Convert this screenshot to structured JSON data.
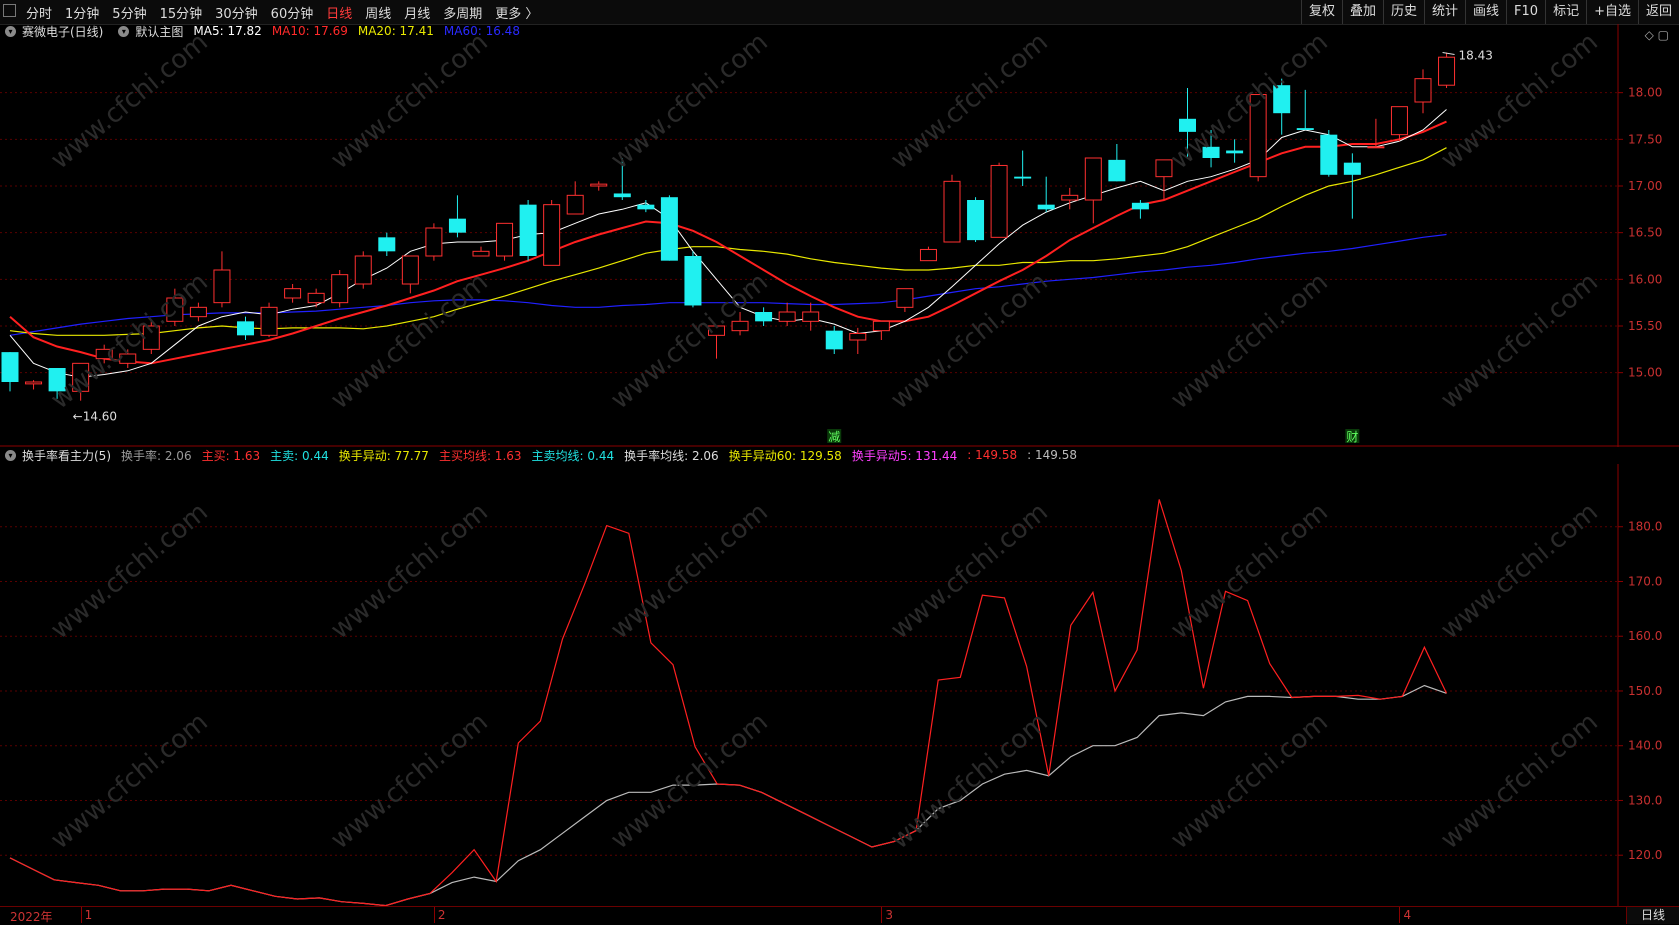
{
  "toolbar": {
    "timeframes": [
      "分时",
      "1分钟",
      "5分钟",
      "15分钟",
      "30分钟",
      "60分钟",
      "日线",
      "周线",
      "月线",
      "多周期",
      "更多 〉"
    ],
    "active_timeframe": "日线",
    "right_buttons": [
      "复权",
      "叠加",
      "历史",
      "统计",
      "画线",
      "F10",
      "标记",
      "+自选",
      "返回"
    ]
  },
  "main_legend": {
    "title": "赛微电子(日线)",
    "main_chart_label": "默认主图",
    "items": [
      {
        "label": "MA5: 17.82",
        "color": "#ffffff"
      },
      {
        "label": "MA10: 17.69",
        "color": "#ff2a2a"
      },
      {
        "label": "MA20: 17.41",
        "color": "#e8e800"
      },
      {
        "label": "MA60: 16.48",
        "color": "#2a2aff"
      }
    ]
  },
  "sub_legend": {
    "title": "换手率看主力(5)",
    "items": [
      {
        "label": "换手率: 2.06",
        "color": "#9a9a9a"
      },
      {
        "label": "主买: 1.63",
        "color": "#ff3030"
      },
      {
        "label": "主卖: 0.44",
        "color": "#20e0e0"
      },
      {
        "label": "换手异动: 77.77",
        "color": "#e8e800"
      },
      {
        "label": "主买均线: 1.63",
        "color": "#ff3030"
      },
      {
        "label": "主卖均线: 0.44",
        "color": "#20e0e0"
      },
      {
        "label": "换手率均线: 2.06",
        "color": "#dddddd"
      },
      {
        "label": "换手异动60: 129.58",
        "color": "#e8e800"
      },
      {
        "label": "换手异动5: 131.44",
        "color": "#ff40ff"
      },
      {
        "label": ": 149.58",
        "color": "#ff3030"
      },
      {
        "label": ": 149.58",
        "color": "#bbbbbb"
      }
    ]
  },
  "price_markers": {
    "high": "18.43",
    "low": "14.60"
  },
  "event_markers": [
    {
      "text": "减",
      "index": 35
    },
    {
      "text": "财",
      "index": 57
    }
  ],
  "watermark": "www.cfchi.com",
  "date_axis": {
    "year_label": "2022年",
    "months": [
      {
        "label": "1",
        "index": 3
      },
      {
        "label": "2",
        "index": 18
      },
      {
        "label": "3",
        "index": 37
      },
      {
        "label": "4",
        "index": 59
      }
    ]
  },
  "bottom_button": "日线",
  "chart_data": [
    {
      "type": "candlestick",
      "title": "赛微电子(日线)",
      "ylim": [
        14.45,
        18.65
      ],
      "y_ticks": [
        "15.00",
        "15.50",
        "16.00",
        "16.50",
        "17.00",
        "17.50",
        "18.00"
      ],
      "y_tick_values": [
        15.0,
        15.5,
        16.0,
        16.5,
        17.0,
        17.5,
        18.0
      ],
      "candles": [
        [
          15.22,
          14.9,
          15.22,
          14.8
        ],
        [
          14.88,
          14.9,
          14.92,
          14.82
        ],
        [
          15.05,
          14.8,
          15.05,
          14.72
        ],
        [
          14.8,
          15.1,
          15.1,
          14.7
        ],
        [
          15.15,
          15.25,
          15.3,
          15.1
        ],
        [
          15.1,
          15.2,
          15.25,
          15.05
        ],
        [
          15.25,
          15.5,
          15.55,
          15.2
        ],
        [
          15.55,
          15.8,
          15.9,
          15.5
        ],
        [
          15.6,
          15.7,
          15.75,
          15.55
        ],
        [
          15.75,
          16.1,
          16.3,
          15.7
        ],
        [
          15.55,
          15.4,
          15.6,
          15.35
        ],
        [
          15.4,
          15.7,
          15.75,
          15.38
        ],
        [
          15.8,
          15.9,
          15.95,
          15.75
        ],
        [
          15.75,
          15.85,
          15.9,
          15.7
        ],
        [
          15.75,
          16.05,
          16.1,
          15.7
        ],
        [
          15.95,
          16.25,
          16.3,
          15.9
        ],
        [
          16.45,
          16.3,
          16.5,
          16.25
        ],
        [
          15.95,
          16.25,
          16.25,
          15.85
        ],
        [
          16.25,
          16.55,
          16.6,
          16.2
        ],
        [
          16.65,
          16.5,
          16.9,
          16.45
        ],
        [
          16.25,
          16.3,
          16.35,
          16.25
        ],
        [
          16.25,
          16.6,
          16.6,
          16.2
        ],
        [
          16.8,
          16.25,
          16.85,
          16.2
        ],
        [
          16.15,
          16.8,
          16.85,
          16.15
        ],
        [
          16.7,
          16.9,
          17.05,
          16.7
        ],
        [
          17.0,
          17.02,
          17.05,
          16.95
        ],
        [
          16.92,
          16.88,
          17.3,
          16.85
        ],
        [
          16.8,
          16.75,
          16.85,
          16.72
        ],
        [
          16.88,
          16.2,
          16.9,
          16.2
        ],
        [
          16.25,
          15.72,
          16.3,
          15.7
        ],
        [
          15.4,
          15.5,
          15.5,
          15.15
        ],
        [
          15.45,
          15.55,
          15.65,
          15.4
        ],
        [
          15.65,
          15.55,
          15.7,
          15.5
        ],
        [
          15.55,
          15.65,
          15.75,
          15.5
        ],
        [
          15.55,
          15.65,
          15.75,
          15.45
        ],
        [
          15.45,
          15.25,
          15.5,
          15.2
        ],
        [
          15.35,
          15.42,
          15.48,
          15.2
        ],
        [
          15.45,
          15.55,
          15.55,
          15.35
        ],
        [
          15.7,
          15.9,
          15.9,
          15.65
        ],
        [
          16.2,
          16.32,
          16.35,
          16.2
        ],
        [
          16.4,
          17.05,
          17.12,
          16.4
        ],
        [
          16.85,
          16.42,
          16.88,
          16.4
        ],
        [
          16.45,
          17.22,
          17.25,
          16.45
        ],
        [
          17.1,
          17.08,
          17.38,
          17.0
        ],
        [
          16.8,
          16.75,
          17.1,
          16.72
        ],
        [
          16.85,
          16.9,
          16.98,
          16.75
        ],
        [
          16.85,
          17.3,
          17.3,
          16.6
        ],
        [
          17.28,
          17.05,
          17.45,
          17.05
        ],
        [
          16.82,
          16.75,
          16.85,
          16.65
        ],
        [
          17.1,
          17.28,
          17.28,
          16.85
        ],
        [
          17.72,
          17.58,
          18.05,
          17.3
        ],
        [
          17.42,
          17.3,
          17.6,
          17.2
        ],
        [
          17.38,
          17.35,
          17.5,
          17.25
        ],
        [
          17.1,
          17.98,
          17.98,
          17.05
        ],
        [
          18.08,
          17.78,
          18.15,
          17.55
        ],
        [
          17.62,
          17.6,
          18.03,
          17.6
        ],
        [
          17.55,
          17.12,
          17.6,
          17.1
        ],
        [
          17.25,
          17.12,
          17.35,
          16.65
        ],
        [
          17.42,
          17.42,
          17.72,
          17.42
        ],
        [
          17.55,
          17.85,
          17.85,
          17.48
        ],
        [
          17.9,
          18.15,
          18.25,
          17.78
        ],
        [
          18.08,
          18.38,
          18.43,
          18.05
        ]
      ],
      "ma5": [
        15.4,
        15.1,
        15.0,
        14.95,
        14.98,
        15.02,
        15.1,
        15.3,
        15.5,
        15.6,
        15.65,
        15.62,
        15.68,
        15.72,
        15.85,
        16.0,
        16.12,
        16.3,
        16.38,
        16.4,
        16.4,
        16.42,
        16.48,
        16.5,
        16.6,
        16.7,
        16.75,
        16.82,
        16.65,
        16.3,
        16.0,
        15.7,
        15.6,
        15.55,
        15.58,
        15.52,
        15.42,
        15.45,
        15.55,
        15.7,
        15.92,
        16.15,
        16.38,
        16.58,
        16.72,
        16.82,
        16.9,
        16.98,
        17.05,
        16.95,
        17.05,
        17.1,
        17.18,
        17.28,
        17.52,
        17.6,
        17.55,
        17.42,
        17.42,
        17.48,
        17.6,
        17.82
      ],
      "ma10": [
        15.6,
        15.38,
        15.28,
        15.22,
        15.15,
        15.12,
        15.1,
        15.15,
        15.2,
        15.25,
        15.3,
        15.35,
        15.42,
        15.5,
        15.58,
        15.65,
        15.72,
        15.8,
        15.88,
        15.98,
        16.05,
        16.12,
        16.2,
        16.3,
        16.4,
        16.48,
        16.55,
        16.62,
        16.6,
        16.52,
        16.4,
        16.25,
        16.1,
        15.95,
        15.82,
        15.7,
        15.6,
        15.55,
        15.55,
        15.6,
        15.72,
        15.85,
        15.98,
        16.1,
        16.25,
        16.42,
        16.55,
        16.68,
        16.8,
        16.85,
        16.95,
        17.05,
        17.15,
        17.25,
        17.35,
        17.42,
        17.42,
        17.45,
        17.45,
        17.5,
        17.58,
        17.69
      ],
      "ma20": [
        15.45,
        15.42,
        15.4,
        15.4,
        15.4,
        15.41,
        15.42,
        15.45,
        15.48,
        15.5,
        15.48,
        15.47,
        15.48,
        15.48,
        15.48,
        15.47,
        15.5,
        15.55,
        15.6,
        15.68,
        15.75,
        15.82,
        15.9,
        15.98,
        16.05,
        16.12,
        16.2,
        16.28,
        16.32,
        16.35,
        16.35,
        16.32,
        16.3,
        16.27,
        16.22,
        16.18,
        16.15,
        16.12,
        16.1,
        16.1,
        16.12,
        16.15,
        16.15,
        16.18,
        16.18,
        16.2,
        16.2,
        16.22,
        16.25,
        16.28,
        16.35,
        16.45,
        16.55,
        16.65,
        16.78,
        16.9,
        17.0,
        17.05,
        17.12,
        17.2,
        17.28,
        17.41
      ],
      "ma60": [
        15.4,
        15.44,
        15.48,
        15.52,
        15.55,
        15.58,
        15.6,
        15.62,
        15.63,
        15.64,
        15.64,
        15.64,
        15.65,
        15.66,
        15.68,
        15.7,
        15.72,
        15.75,
        15.77,
        15.78,
        15.78,
        15.77,
        15.75,
        15.72,
        15.7,
        15.7,
        15.72,
        15.73,
        15.75,
        15.75,
        15.75,
        15.75,
        15.75,
        15.74,
        15.73,
        15.73,
        15.74,
        15.75,
        15.78,
        15.82,
        15.86,
        15.9,
        15.92,
        15.95,
        15.98,
        16.0,
        16.02,
        16.05,
        16.08,
        16.1,
        16.13,
        16.15,
        16.18,
        16.22,
        16.25,
        16.28,
        16.3,
        16.33,
        16.37,
        16.41,
        16.45,
        16.48
      ]
    },
    {
      "type": "line",
      "title": "换手率看主力(5)",
      "ylim": [
        112,
        190
      ],
      "y_ticks": [
        "120.0",
        "130.0",
        "140.0",
        "150.0",
        "160.0",
        "170.0",
        "180.0"
      ],
      "y_tick_values": [
        120,
        130,
        140,
        150,
        160,
        170,
        180
      ],
      "series": [
        {
          "name": "换手异动5",
          "color": "#ff2020",
          "values": [
            119.5,
            117.5,
            115.5,
            115.0,
            114.5,
            113.5,
            113.5,
            113.8,
            113.8,
            113.5,
            114.5,
            113.5,
            112.5,
            112.0,
            112.2,
            111.5,
            111.2,
            110.8,
            112.0,
            113.0,
            116.8,
            121.0,
            115.2,
            140.5,
            144.5,
            159.5,
            169.5,
            180.2,
            178.8,
            158.8,
            154.8,
            139.8,
            133.0,
            132.8,
            131.5,
            129.5,
            127.5,
            125.5,
            123.5,
            121.5,
            122.5,
            124.5,
            152.0,
            152.5,
            167.5,
            167.0,
            154.5,
            134.5,
            162.0,
            168.0,
            150.0,
            157.5,
            185.0,
            172.0,
            150.5,
            168.2,
            166.5,
            155.0,
            148.8,
            149.0,
            149.0,
            149.2,
            148.5,
            149.0,
            158.0,
            149.58
          ]
        },
        {
          "name": "换手异动60",
          "color": "#bbbbbb",
          "values": [
            119.5,
            117.5,
            115.5,
            115.0,
            114.5,
            113.5,
            113.5,
            113.8,
            113.8,
            113.5,
            114.5,
            113.5,
            112.5,
            112.0,
            112.2,
            111.5,
            111.2,
            110.8,
            112.0,
            113.0,
            115.0,
            116.0,
            115.2,
            119.0,
            121.0,
            124.0,
            127.0,
            130.0,
            131.5,
            131.5,
            132.8,
            132.8,
            133.0,
            132.8,
            131.5,
            129.5,
            127.5,
            125.5,
            123.5,
            121.5,
            122.5,
            124.5,
            128.5,
            130.0,
            133.0,
            134.8,
            135.5,
            134.5,
            138.0,
            140.0,
            140.0,
            141.5,
            145.5,
            146.0,
            145.5,
            148.0,
            149.0,
            149.0,
            148.8,
            149.0,
            149.0,
            148.5,
            148.5,
            149.0,
            151.0,
            149.58
          ]
        }
      ]
    }
  ]
}
